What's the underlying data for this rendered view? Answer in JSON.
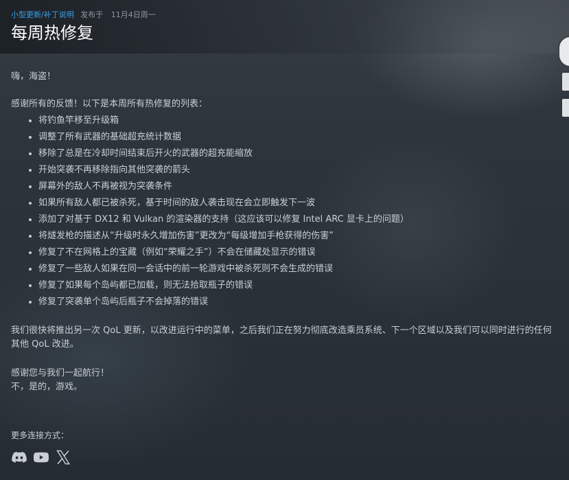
{
  "header": {
    "category": "小型更新/补丁说明",
    "published_label": "发布于",
    "date": "11月4日周一",
    "title": "每周热修复"
  },
  "body": {
    "greeting": "嗨，海盗！",
    "intro": "感谢所有的反馈！以下是本周所有热修复的列表：",
    "fixes": [
      "将钓鱼竿移至升级箱",
      "调整了所有武器的基础超充统计数据",
      "移除了总是在冷却时间结束后开火的武器的超充能缩放",
      "开始突袭不再移除指向其他突袭的箭头",
      "屏幕外的敌人不再被视为突袭条件",
      "如果所有敌人都已被杀死，基于时间的敌人袭击现在会立即触发下一波",
      "添加了对基于 DX12 和 Vulkan 的渲染器的支持（这应该可以修复 Intel ARC 显卡上的问题）",
      "将燧发枪的描述从“升级时永久增加伤害”更改为“每级增加手枪获得的伤害”",
      "修复了不在网格上的宝藏（例如“荣耀之手”）不会在储藏处显示的错误",
      "修复了一些敌人如果在同一会话中的前一轮游戏中被杀死则不会生成的错误",
      "修复了如果每个岛屿都已加载，则无法拾取瓶子的错误",
      "修复了突袭单个岛屿后瓶子不会掉落的错误"
    ],
    "outro": "我们很快将推出另一次 QoL 更新，以改进运行中的菜单，之后我们正在努力彻底改造乘员系统、下一个区域以及我们可以同时进行的任何其他 QoL 改进。",
    "thanks": "感谢您与我们一起航行！",
    "signoff": "不，是的，游戏。"
  },
  "footer": {
    "more_label": "更多连接方式：",
    "socials": [
      "discord-icon",
      "youtube-icon",
      "x-icon"
    ]
  },
  "colors": {
    "category_link": "#3d9ee6",
    "title": "#ffffff",
    "body_text": "#c9cfd5",
    "meta_text": "#8f98a0"
  }
}
